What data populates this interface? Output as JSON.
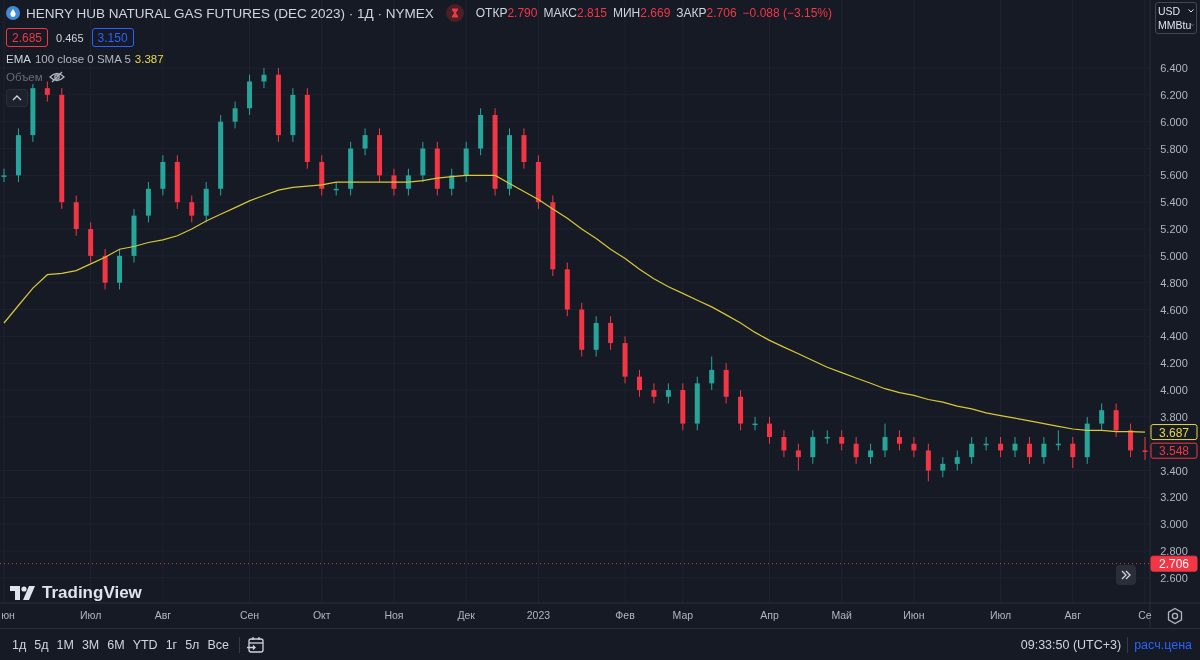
{
  "header": {
    "title": "HENRY HUB NATURAL GAS FUTURES (DEC 2023) · 1Д · NYMEX",
    "market_closed": true,
    "ohlc": [
      {
        "label": "ОТКР",
        "value": "2.790"
      },
      {
        "label": "МАКС",
        "value": "2.815"
      },
      {
        "label": "МИН",
        "value": "2.669"
      },
      {
        "label": "ЗАКР",
        "value": "2.706"
      }
    ],
    "change": "−0.088 (−3.15%)"
  },
  "quote": {
    "bid": "2.685",
    "spread": "0.465",
    "ask": "3.150"
  },
  "indicator": {
    "params": "100 close 0 SMA 5",
    "value": "3.387"
  },
  "volume": {
    "label": "Объем",
    "hidden": true
  },
  "units": {
    "currency": "USD",
    "unit": "MMBtu"
  },
  "chart_data": {
    "type": "candlestick",
    "ylim": [
      2.413,
      6.907
    ],
    "categories": [
      "юн",
      null,
      null,
      null,
      null,
      null,
      "Июл",
      null,
      null,
      null,
      null,
      "Авг",
      null,
      null,
      null,
      null,
      null,
      "Сен",
      null,
      null,
      null,
      null,
      "Окт",
      null,
      null,
      null,
      null,
      "Ноя",
      null,
      null,
      null,
      null,
      "Дек",
      null,
      null,
      null,
      null,
      "2023",
      null,
      null,
      null,
      null,
      null,
      "Фев",
      null,
      null,
      null,
      "Мар",
      null,
      null,
      null,
      null,
      null,
      "Апр",
      null,
      null,
      null,
      null,
      "Май",
      null,
      null,
      null,
      null,
      "Июн",
      null,
      null,
      null,
      null,
      null,
      "Июл",
      null,
      null,
      null,
      null,
      "Авг",
      null,
      null,
      null,
      null,
      "Се"
    ],
    "ohlc": [
      [
        5.6,
        5.65,
        5.55,
        5.6
      ],
      [
        5.6,
        5.95,
        5.55,
        5.9
      ],
      [
        5.9,
        6.28,
        5.85,
        6.25
      ],
      [
        6.25,
        6.3,
        6.15,
        6.2
      ],
      [
        6.2,
        6.25,
        5.35,
        5.4
      ],
      [
        5.4,
        5.45,
        5.15,
        5.2
      ],
      [
        5.2,
        5.25,
        4.95,
        5.0
      ],
      [
        5.0,
        5.05,
        4.75,
        4.8
      ],
      [
        4.8,
        5.05,
        4.75,
        5.0
      ],
      [
        5.0,
        5.35,
        4.95,
        5.3
      ],
      [
        5.3,
        5.55,
        5.25,
        5.5
      ],
      [
        5.5,
        5.75,
        5.45,
        5.7
      ],
      [
        5.7,
        5.75,
        5.35,
        5.4
      ],
      [
        5.4,
        5.45,
        5.25,
        5.3
      ],
      [
        5.3,
        5.55,
        5.25,
        5.5
      ],
      [
        5.5,
        6.05,
        5.45,
        6.0
      ],
      [
        6.0,
        6.15,
        5.95,
        6.1
      ],
      [
        6.1,
        6.35,
        6.05,
        6.3
      ],
      [
        6.3,
        6.4,
        6.25,
        6.35
      ],
      [
        6.35,
        6.4,
        5.85,
        5.9
      ],
      [
        5.9,
        6.25,
        5.85,
        6.2
      ],
      [
        6.2,
        6.25,
        5.65,
        5.7
      ],
      [
        5.7,
        5.75,
        5.45,
        5.5
      ],
      [
        5.5,
        5.55,
        5.45,
        5.5
      ],
      [
        5.5,
        5.85,
        5.45,
        5.8
      ],
      [
        5.8,
        5.95,
        5.75,
        5.9
      ],
      [
        5.9,
        5.95,
        5.55,
        5.6
      ],
      [
        5.6,
        5.65,
        5.45,
        5.5
      ],
      [
        5.5,
        5.65,
        5.45,
        5.6
      ],
      [
        5.6,
        5.85,
        5.55,
        5.8
      ],
      [
        5.8,
        5.85,
        5.45,
        5.5
      ],
      [
        5.5,
        5.65,
        5.45,
        5.6
      ],
      [
        5.6,
        5.85,
        5.55,
        5.8
      ],
      [
        5.8,
        6.1,
        5.75,
        6.05
      ],
      [
        6.05,
        6.1,
        5.45,
        5.5
      ],
      [
        5.5,
        5.95,
        5.45,
        5.9
      ],
      [
        5.9,
        5.95,
        5.65,
        5.7
      ],
      [
        5.7,
        5.75,
        5.35,
        5.4
      ],
      [
        5.4,
        5.45,
        4.85,
        4.9
      ],
      [
        4.9,
        4.95,
        4.55,
        4.6
      ],
      [
        4.6,
        4.65,
        4.25,
        4.3
      ],
      [
        4.3,
        4.55,
        4.25,
        4.5
      ],
      [
        4.5,
        4.55,
        4.3,
        4.35
      ],
      [
        4.35,
        4.4,
        4.05,
        4.1
      ],
      [
        4.1,
        4.15,
        3.95,
        4.0
      ],
      [
        4.0,
        4.05,
        3.9,
        3.95
      ],
      [
        3.95,
        4.05,
        3.9,
        4.0
      ],
      [
        4.0,
        4.05,
        3.7,
        3.75
      ],
      [
        3.75,
        4.1,
        3.7,
        4.05
      ],
      [
        4.05,
        4.25,
        4.0,
        4.15
      ],
      [
        4.15,
        4.2,
        3.9,
        3.95
      ],
      [
        3.95,
        4.0,
        3.7,
        3.75
      ],
      [
        3.75,
        3.8,
        3.7,
        3.75
      ],
      [
        3.75,
        3.8,
        3.6,
        3.65
      ],
      [
        3.65,
        3.7,
        3.5,
        3.55
      ],
      [
        3.55,
        3.6,
        3.4,
        3.5
      ],
      [
        3.5,
        3.7,
        3.45,
        3.65
      ],
      [
        3.65,
        3.7,
        3.6,
        3.65
      ],
      [
        3.65,
        3.7,
        3.55,
        3.6
      ],
      [
        3.6,
        3.65,
        3.45,
        3.5
      ],
      [
        3.5,
        3.6,
        3.45,
        3.55
      ],
      [
        3.55,
        3.75,
        3.5,
        3.65
      ],
      [
        3.65,
        3.7,
        3.55,
        3.6
      ],
      [
        3.6,
        3.65,
        3.5,
        3.55
      ],
      [
        3.55,
        3.6,
        3.32,
        3.4
      ],
      [
        3.4,
        3.5,
        3.35,
        3.45
      ],
      [
        3.45,
        3.55,
        3.4,
        3.5
      ],
      [
        3.5,
        3.65,
        3.45,
        3.6
      ],
      [
        3.6,
        3.65,
        3.55,
        3.6
      ],
      [
        3.6,
        3.65,
        3.5,
        3.55
      ],
      [
        3.55,
        3.65,
        3.5,
        3.6
      ],
      [
        3.6,
        3.65,
        3.45,
        3.5
      ],
      [
        3.5,
        3.65,
        3.45,
        3.6
      ],
      [
        3.6,
        3.7,
        3.55,
        3.6
      ],
      [
        3.6,
        3.65,
        3.42,
        3.5
      ],
      [
        3.5,
        3.8,
        3.45,
        3.75
      ],
      [
        3.75,
        3.9,
        3.7,
        3.85
      ],
      [
        3.85,
        3.9,
        3.65,
        3.7
      ],
      [
        3.7,
        3.75,
        3.5,
        3.55
      ],
      [
        3.55,
        3.65,
        3.48,
        3.548
      ]
    ],
    "series": [
      {
        "name": "EMA",
        "type": "line",
        "color": "#d8c736",
        "values": [
          4.5,
          4.63,
          4.76,
          4.86,
          4.87,
          4.89,
          4.94,
          4.99,
          5.05,
          5.07,
          5.1,
          5.12,
          5.15,
          5.2,
          5.26,
          5.31,
          5.36,
          5.41,
          5.45,
          5.49,
          5.51,
          5.52,
          5.53,
          5.55,
          5.55,
          5.55,
          5.55,
          5.55,
          5.55,
          5.56,
          5.58,
          5.59,
          5.6,
          5.6,
          5.6,
          5.54,
          5.48,
          5.42,
          5.35,
          5.28,
          5.2,
          5.13,
          5.05,
          4.98,
          4.9,
          4.83,
          4.77,
          4.72,
          4.67,
          4.62,
          4.56,
          4.5,
          4.43,
          4.37,
          4.32,
          4.27,
          4.22,
          4.17,
          4.13,
          4.09,
          4.05,
          4.01,
          3.98,
          3.96,
          3.93,
          3.91,
          3.88,
          3.86,
          3.83,
          3.81,
          3.79,
          3.77,
          3.75,
          3.73,
          3.71,
          3.7,
          3.7,
          3.69,
          3.69,
          3.687
        ]
      }
    ],
    "yticks": [
      {
        "value": 6.4,
        "label": "6.400"
      },
      {
        "value": 6.2,
        "label": "6.200"
      },
      {
        "value": 6.0,
        "label": "6.000"
      },
      {
        "value": 5.8,
        "label": "5.800"
      },
      {
        "value": 5.6,
        "label": "5.600"
      },
      {
        "value": 5.4,
        "label": "5.400"
      },
      {
        "value": 5.2,
        "label": "5.200"
      },
      {
        "value": 5.0,
        "label": "5.000"
      },
      {
        "value": 4.8,
        "label": "4.800"
      },
      {
        "value": 4.6,
        "label": "4.600"
      },
      {
        "value": 4.4,
        "label": "4.400"
      },
      {
        "value": 4.2,
        "label": "4.200"
      },
      {
        "value": 4.0,
        "label": "4.000"
      },
      {
        "value": 3.8,
        "label": "3.800"
      },
      {
        "value": 3.4,
        "label": "3.400"
      },
      {
        "value": 3.2,
        "label": "3.200"
      },
      {
        "value": 3.0,
        "label": "3.000"
      },
      {
        "value": 2.8,
        "label": "2.800"
      },
      {
        "value": 2.6,
        "label": "2.600"
      }
    ],
    "annotations": [
      "3.687",
      "3.548"
    ],
    "ref_lines": [
      {
        "axis": "y",
        "value": 2.706,
        "label": "2.706"
      }
    ],
    "grid": true
  },
  "price_tags": [
    {
      "kind": "ema"
    },
    {
      "kind": "close"
    }
  ],
  "range_buttons": [
    "1д",
    "5д",
    "1М",
    "3М",
    "6М",
    "YTD",
    "1г",
    "5л",
    "Все"
  ],
  "clock": "09:33:50 (UTC+3)",
  "price_source": "расч.цена",
  "logo": "TradingView"
}
